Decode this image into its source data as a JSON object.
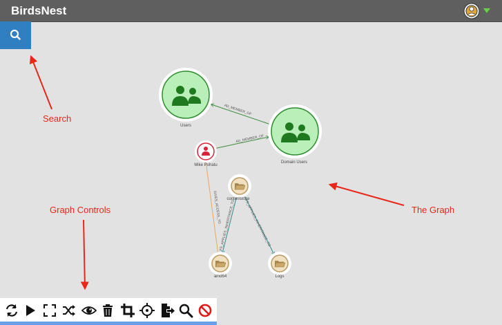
{
  "app": {
    "title": "BirdsNest"
  },
  "colors": {
    "topbar": "#5f5f5f",
    "search_button": "#2f7fc1",
    "canvas": "#e2e2e2",
    "group_fill": "#b9f0b9",
    "group_border": "#2e8b2e",
    "group_icon": "#1f7a1f",
    "user_border": "#d8243a",
    "folder_fill": "#f2e1c0",
    "folder_border": "#b89a62",
    "annotation": "#e8261a"
  },
  "icons": {
    "search": "search-icon",
    "user_menu": "user-avatar-icon",
    "dropdown": "chevron-down-icon"
  },
  "annotations": {
    "search": "Search",
    "graph_controls": "Graph Controls",
    "the_graph": "The Graph"
  },
  "graph": {
    "nodes": {
      "users": "Users",
      "domain_users": "Domain Users",
      "mike": "Mike Pohatu",
      "contentstore": "contentstore",
      "amd64": "amd64",
      "logs": "Logs"
    },
    "edges": {
      "users_domain": "AD_MEMBER_OF",
      "mike_domain": "AD_MEMBER_OF",
      "mike_amd64": "GIVES_ACCESS_TO",
      "content_amd64": "FS_APPLIES_INHERITANCE_TO",
      "content_logs": "FS_APPLIES_INHERITANCE_TO"
    }
  },
  "toolbar": [
    {
      "name": "refresh-icon"
    },
    {
      "name": "play-icon"
    },
    {
      "name": "fit-screen-icon"
    },
    {
      "name": "shuffle-icon"
    },
    {
      "name": "eye-icon"
    },
    {
      "name": "trash-icon"
    },
    {
      "name": "crop-icon"
    },
    {
      "name": "crosshair-icon"
    },
    {
      "name": "export-icon"
    },
    {
      "name": "search-icon"
    },
    {
      "name": "no-entry-icon"
    }
  ]
}
